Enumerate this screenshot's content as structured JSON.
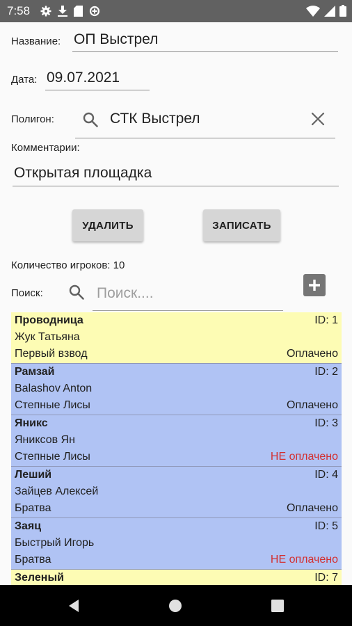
{
  "status_bar": {
    "time": "7:58"
  },
  "form": {
    "name_label": "Название:",
    "name_value": "ОП Выстрел",
    "date_label": "Дата:",
    "date_value": "09.07.2021",
    "polygon_label": "Полигон:",
    "polygon_value": "СТК Выстрел",
    "comment_label": "Комментарии:",
    "comment_value": "Открытая площадка"
  },
  "buttons": {
    "delete_label": "УДАЛИТЬ",
    "save_label": "ЗАПИСАТЬ"
  },
  "players_count_label": "Количество игроков: 10",
  "search": {
    "label": "Поиск:",
    "placeholder": "Поиск...."
  },
  "players": [
    {
      "nickname": "Проводница",
      "id": "ID: 1",
      "name": "Жук Татьяна",
      "team": "Первый взвод",
      "payment": "Оплачено",
      "paid": true,
      "color": "yellow"
    },
    {
      "nickname": "Рамзай",
      "id": "ID: 2",
      "name": "Balashov Anton",
      "team": "Степные Лисы",
      "payment": "Оплачено",
      "paid": true,
      "color": "blue"
    },
    {
      "nickname": "Яникс",
      "id": "ID: 3",
      "name": "Яниксов Ян",
      "team": "Степные Лисы",
      "payment": "НЕ оплачено",
      "paid": false,
      "color": "blue"
    },
    {
      "nickname": "Леший",
      "id": "ID: 4",
      "name": "Зайцев Алексей",
      "team": "Братва",
      "payment": "Оплачено",
      "paid": true,
      "color": "blue"
    },
    {
      "nickname": "Заяц",
      "id": "ID: 5",
      "name": "Быстрый Игорь",
      "team": "Братва",
      "payment": "НЕ оплачено",
      "paid": false,
      "color": "blue"
    },
    {
      "nickname": "Зеленый",
      "id": "ID: 7",
      "name": "",
      "team": "",
      "payment": "",
      "paid": true,
      "color": "yellow"
    }
  ],
  "colors": {
    "card_yellow": "#fdfcb4",
    "card_blue": "#b0c3f4",
    "unpaid_text": "#d32f2f",
    "status_bar": "#616161",
    "nav_bar": "#000000"
  },
  "icons": [
    "settings-icon",
    "download-icon",
    "sd-card-icon",
    "data-saver-icon",
    "wifi-icon",
    "signal-icon",
    "battery-icon",
    "search-icon",
    "close-icon",
    "add-icon",
    "back-icon",
    "home-icon",
    "recents-icon"
  ]
}
